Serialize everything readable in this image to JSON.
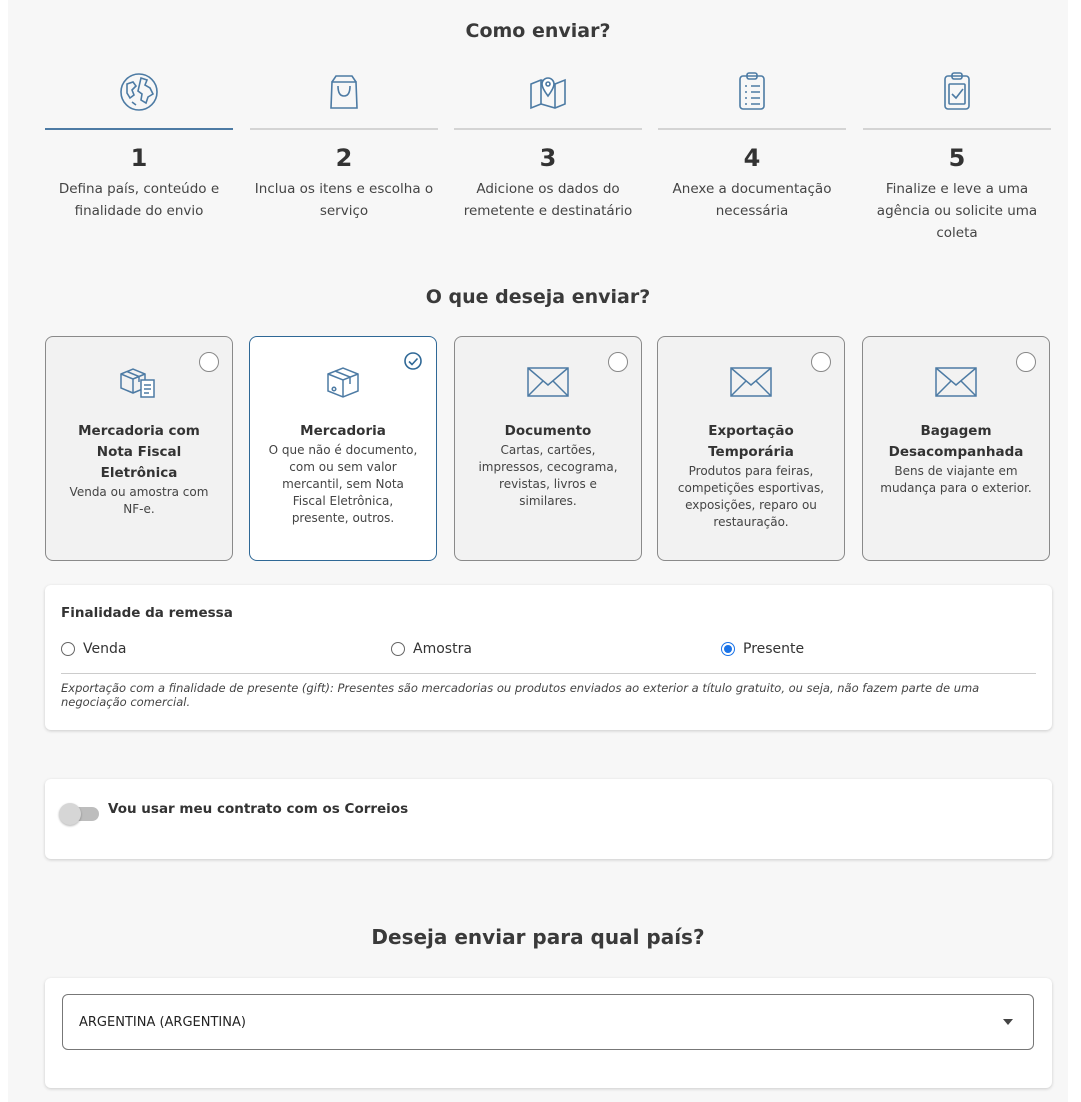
{
  "how_to_send": {
    "title": "Como enviar?",
    "steps": [
      {
        "icon": "globe-icon",
        "number": "1",
        "description": "Defina país, conteúdo e finalidade do envio"
      },
      {
        "icon": "shopping-bag-icon",
        "number": "2",
        "description": "Inclua os itens e escolha o serviço"
      },
      {
        "icon": "map-pin-icon",
        "number": "3",
        "description": "Adicione os dados do remetente e destinatário"
      },
      {
        "icon": "clipboard-list-icon",
        "number": "4",
        "description": "Anexe a documentação necessária"
      },
      {
        "icon": "clipboard-check-icon",
        "number": "5",
        "description": "Finalize e leve a uma agência ou solicite uma coleta"
      }
    ]
  },
  "what_to_send": {
    "title": "O que deseja enviar?",
    "options": [
      {
        "icon": "boxes-invoice-icon",
        "title": "Mercadoria com Nota Fiscal Eletrônica",
        "description": "Venda ou amostra com NF-e.",
        "selected": false
      },
      {
        "icon": "box-icon",
        "title": "Mercadoria",
        "description": "O que não é documento, com ou sem valor mercantil, sem Nota Fiscal Eletrônica, presente, outros.",
        "selected": true
      },
      {
        "icon": "envelope-icon",
        "title": "Documento",
        "description": "Cartas, cartões, impressos, cecograma, revistas, livros e similares.",
        "selected": false
      },
      {
        "icon": "envelope-icon",
        "title": "Exportação Temporária",
        "description": "Produtos para feiras, competições esportivas, exposições, reparo ou restauração.",
        "selected": false
      },
      {
        "icon": "envelope-icon",
        "title": "Bagagem Desacompanhada",
        "description": "Bens de viajante em mudança para o exterior.",
        "selected": false
      }
    ]
  },
  "purpose": {
    "label": "Finalidade da remessa",
    "options": [
      {
        "label": "Venda",
        "selected": false
      },
      {
        "label": "Amostra",
        "selected": false
      },
      {
        "label": "Presente",
        "selected": true
      }
    ],
    "note": "Exportação com a finalidade de presente (gift): Presentes são mercadorias ou produtos enviados ao exterior a título gratuito, ou seja, não fazem parte de uma negociação comercial."
  },
  "contract": {
    "label": "Vou usar meu contrato com os Correios",
    "enabled": false
  },
  "country": {
    "title": "Deseja enviar para qual país?",
    "selected": "ARGENTINA (ARGENTINA)"
  },
  "colors": {
    "accent": "#2f6896",
    "radio_selected": "#1a73e8",
    "icon_stroke": "#4d7ba4"
  }
}
